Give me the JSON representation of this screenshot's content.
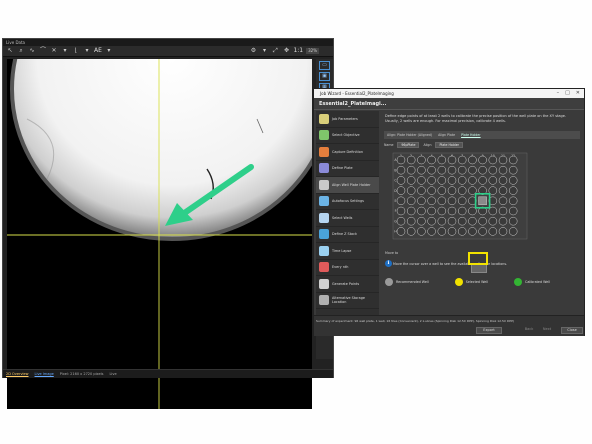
{
  "live_window": {
    "title": "Live Data",
    "toolbar": {
      "ae_label": "AE",
      "ratio_label": "1:1",
      "zoom_label": "32%"
    },
    "side_zoom": "32%",
    "status": {
      "tab_overview": "2D Overview",
      "tab_live": "Live Image",
      "size_text": "Pixel: 2160 x 2720 pixels",
      "extra": "Live"
    }
  },
  "wizard": {
    "title": "Job Wizard - Essential2_PlateImaging",
    "header": "Essential2_PlateImagi...",
    "nav": [
      {
        "label": "Job Parameters",
        "icon": "job-parameters-icon",
        "color": "#d9cf7a"
      },
      {
        "label": "Select Objective",
        "icon": "objective-icon",
        "color": "#7fc56b"
      },
      {
        "label": "Capture Definition",
        "icon": "capture-icon",
        "color": "#e57f3d"
      },
      {
        "label": "Define Plate",
        "icon": "plate-icon",
        "color": "#8b8bd9"
      },
      {
        "label": "Align Well Plate Holder",
        "icon": "align-icon",
        "color": "#c9c9c9"
      },
      {
        "label": "Autofocus Settings",
        "icon": "autofocus-icon",
        "color": "#6bb3e5"
      },
      {
        "label": "Select Wells",
        "icon": "wells-icon",
        "color": "#b6d5f0"
      },
      {
        "label": "Define Z Stack",
        "icon": "zstack-icon",
        "color": "#4aa3d9"
      },
      {
        "label": "Time Lapse",
        "icon": "timelapse-icon",
        "color": "#9ad0f0"
      },
      {
        "label": "Every nth",
        "icon": "every-nth-icon",
        "color": "#e05b5b"
      },
      {
        "label": "Generate Points",
        "icon": "points-icon",
        "color": "#d0d0d0"
      },
      {
        "label": "Alternative Storage Location",
        "icon": "storage-icon",
        "color": "#b0b0b0"
      }
    ],
    "description": "Define edge points of at least 2 wells to calibrate the precise position of the well plate on the XY stage. Usually, 2 wells are enough. For maximal precision, calibrate 4 wells.",
    "align_bar": {
      "label": "Align: Plate Holder (Aligned)",
      "type_label": "Align Plate",
      "value": "Plate Holder"
    },
    "selectors": {
      "name_label": "Name",
      "name_value": "96pPlate",
      "align_label": "Align",
      "align_value": "Plate Holder"
    },
    "plate": {
      "columns": [
        "1",
        "2",
        "3",
        "4",
        "5",
        "6",
        "7",
        "8",
        "9",
        "10",
        "11",
        "12"
      ],
      "rows": [
        "A",
        "B",
        "C",
        "D",
        "E",
        "F",
        "G",
        "H"
      ]
    },
    "help_label": "Move to",
    "help_text": "Move the cursor over a well to see the available well move locations.",
    "legend": [
      {
        "label": "Recommended Well",
        "color": "#9a9a9a"
      },
      {
        "label": "Selected Well",
        "color": "#f2e200"
      },
      {
        "label": "Calibrated Well",
        "color": "#33b533"
      }
    ],
    "summary": "Summary of experiment: 96 well plate, 1 well, 16 tiles (Convenient), 2 z-slices (Spinning Disk 12.5X DPP), Spinning Disk 12.5X DPP)",
    "warning": "",
    "buttons": {
      "export": "Export",
      "back": "Back",
      "next": "Next",
      "close": "Close"
    }
  },
  "annotations": {
    "arrow_color": "#2ecf8a",
    "highlight_yellow": "#f2e200",
    "highlight_green": "#2ecf8a"
  }
}
